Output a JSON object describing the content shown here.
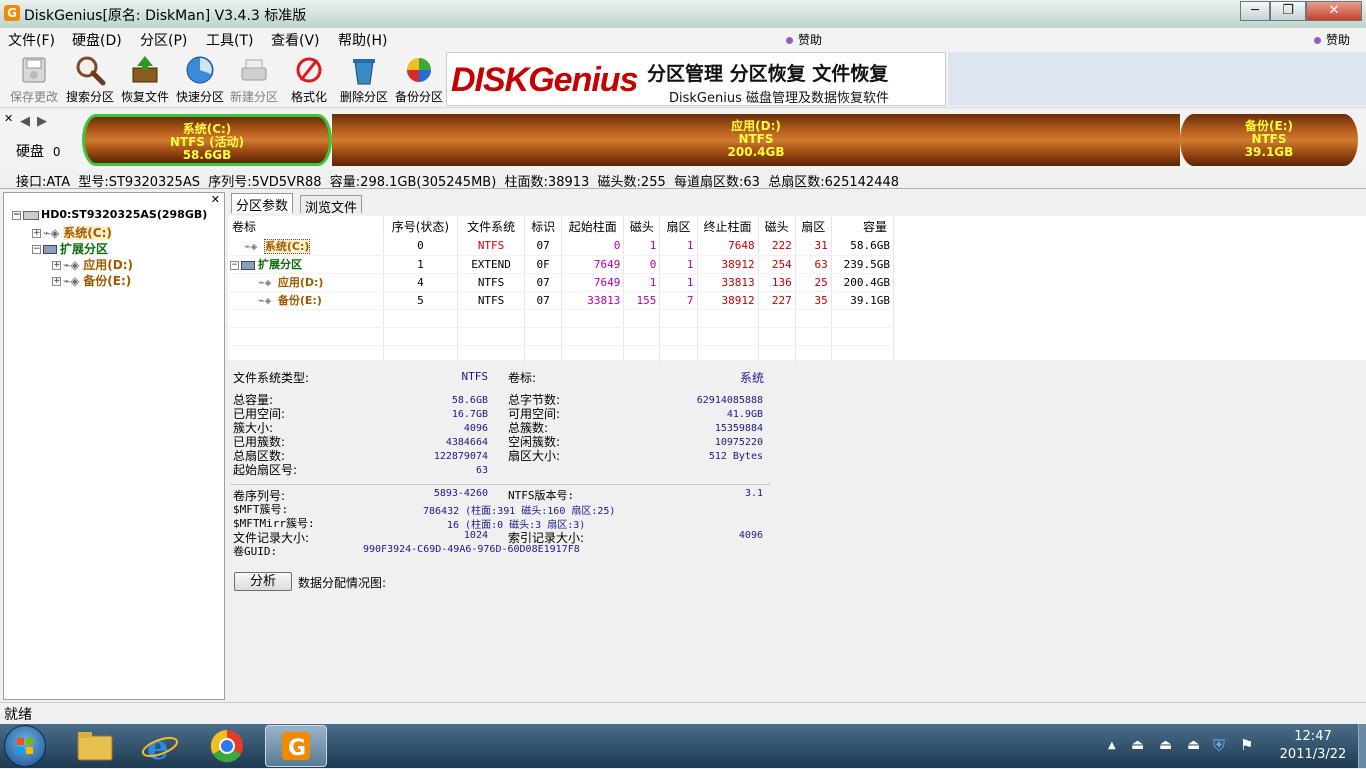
{
  "window": {
    "title": "DiskGenius[原名: DiskMan] V3.4.3 标准版",
    "app_icon_letter": "G"
  },
  "menu": {
    "items": [
      "文件(F)",
      "硬盘(D)",
      "分区(P)",
      "工具(T)",
      "查看(V)",
      "帮助(H)"
    ],
    "donate": "赞助"
  },
  "toolbar": {
    "buttons": [
      "保存更改",
      "搜索分区",
      "恢复文件",
      "快速分区",
      "新建分区",
      "格式化",
      "删除分区",
      "备份分区"
    ]
  },
  "banner": {
    "logo": "DISKGenius",
    "headline": "分区管理 分区恢复 文件恢复",
    "subtitle": "DiskGenius 磁盘管理及数据恢复软件"
  },
  "diskmap": {
    "disk_label": "硬盘",
    "disk_index": "0",
    "partitions": [
      {
        "name": "系统(C:)",
        "fs": "NTFS (活动)",
        "size": "58.6GB"
      },
      {
        "name": "应用(D:)",
        "fs": "NTFS",
        "size": "200.4GB"
      },
      {
        "name": "备份(E:)",
        "fs": "NTFS",
        "size": "39.1GB"
      }
    ]
  },
  "info_line": "接口:ATA  型号:ST9320325AS  序列号:5VD5VR88  容量:298.1GB(305245MB)  柱面数:38913  磁头数:255  每道扇区数:63  总扇区数:625142448",
  "tree": {
    "disk": "HD0:ST9320325AS(298GB)",
    "items": [
      {
        "label": "系统(C:)"
      },
      {
        "label": "扩展分区"
      },
      {
        "label": "应用(D:)"
      },
      {
        "label": "备份(E:)"
      }
    ]
  },
  "tabs": [
    "分区参数",
    "浏览文件"
  ],
  "table": {
    "headers": [
      "卷标",
      "序号(状态)",
      "文件系统",
      "标识",
      "起始柱面",
      "磁头",
      "扇区",
      "终止柱面",
      "磁头",
      "扇区",
      "容量"
    ],
    "rows": [
      [
        "系统(C:)",
        "0",
        "NTFS",
        "07",
        "0",
        "1",
        "1",
        "7648",
        "222",
        "31",
        "58.6GB"
      ],
      [
        "扩展分区",
        "1",
        "EXTEND",
        "0F",
        "7649",
        "0",
        "1",
        "38912",
        "254",
        "63",
        "239.5GB"
      ],
      [
        "应用(D:)",
        "4",
        "NTFS",
        "07",
        "7649",
        "1",
        "1",
        "33813",
        "136",
        "25",
        "200.4GB"
      ],
      [
        "备份(E:)",
        "5",
        "NTFS",
        "07",
        "33813",
        "155",
        "7",
        "38912",
        "227",
        "35",
        "39.1GB"
      ]
    ]
  },
  "details": {
    "fs_type_label": "文件系统类型:",
    "fs_type": "NTFS",
    "vol_label_label": "卷标:",
    "vol_label": "系统",
    "left": [
      [
        "总容量:",
        "58.6GB"
      ],
      [
        "已用空间:",
        "16.7GB"
      ],
      [
        "簇大小:",
        "4096"
      ],
      [
        "已用簇数:",
        "4384664"
      ],
      [
        "总扇区数:",
        "122879074"
      ],
      [
        "起始扇区号:",
        "63"
      ]
    ],
    "right": [
      [
        "总字节数:",
        "62914085888"
      ],
      [
        "可用空间:",
        "41.9GB"
      ],
      [
        "总簇数:",
        "15359884"
      ],
      [
        "空闲簇数:",
        "10975220"
      ],
      [
        "扇区大小:",
        "512 Bytes"
      ]
    ],
    "serial_label": "卷序列号:",
    "serial": "5893-4260",
    "ntfs_ver_label": "NTFS版本号:",
    "ntfs_ver": "3.1",
    "mft_label": "$MFT簇号:",
    "mft": "786432 (柱面:391 磁头:160 扇区:25)",
    "mftmirr_label": "$MFTMirr簇号:",
    "mftmirr": "16 (柱面:0 磁头:3 扇区:3)",
    "rec_size_label": "文件记录大小:",
    "rec_size": "1024",
    "idx_size_label": "索引记录大小:",
    "idx_size": "4096",
    "guid_label": "卷GUID:",
    "guid": "990F3924-C69D-49A6-976D-60D08E1917F8",
    "analyze_btn": "分析",
    "alloc_label": "数据分配情况图:"
  },
  "status": "就绪",
  "clock": {
    "time": "12:47",
    "date": "2011/3/22"
  }
}
